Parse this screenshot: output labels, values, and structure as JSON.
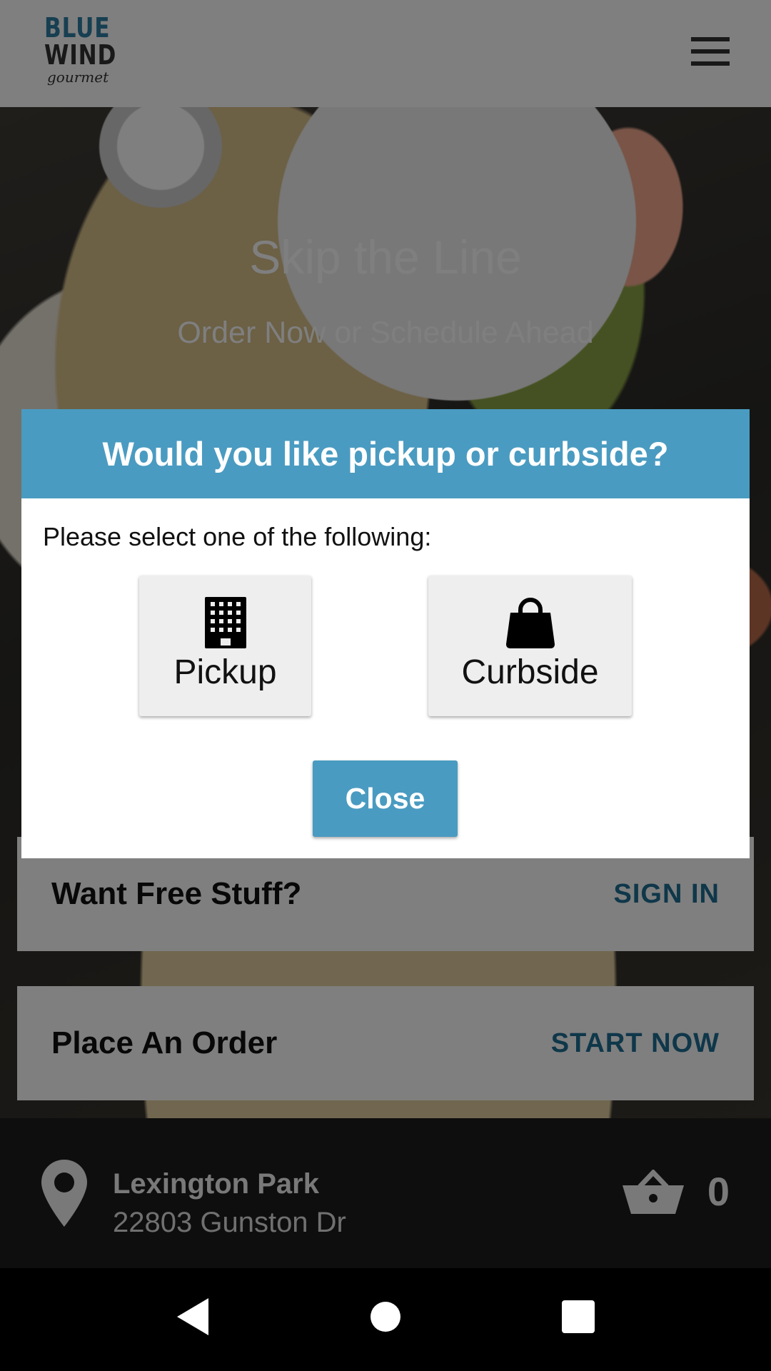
{
  "app": {
    "logo": {
      "line1": "BLUE",
      "line2": "WIND",
      "line3": "gourmet"
    }
  },
  "hero": {
    "title": "Skip the Line",
    "subtitle": "Order Now or Schedule Ahead"
  },
  "cards": {
    "free_stuff": {
      "label": "Want Free Stuff?",
      "action": "SIGN IN"
    },
    "order": {
      "label": "Place An Order",
      "action": "START NOW"
    }
  },
  "location": {
    "name": "Lexington Park",
    "address": "22803 Gunston Dr"
  },
  "cart": {
    "count": "0"
  },
  "dialog": {
    "title": "Would you like pickup or curbside?",
    "prompt": "Please select one of the following:",
    "options": [
      {
        "label": "Pickup",
        "icon": "building-icon"
      },
      {
        "label": "Curbside",
        "icon": "shopping-bag-icon"
      }
    ],
    "close_label": "Close"
  },
  "colors": {
    "accent": "#4a9bc1",
    "link": "#1f6f94",
    "logo_blue": "#2f7fa4"
  }
}
